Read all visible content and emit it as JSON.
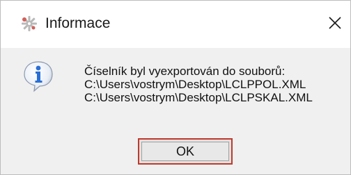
{
  "window": {
    "title": "Informace",
    "title_icon": "gear-cluster-icon",
    "close_glyph": "✕"
  },
  "message": {
    "icon": "information-icon",
    "lines": [
      "Číselník byl vyexportován do souborů:",
      "C:\\Users\\vostrym\\Desktop\\LCLPPOL.XML",
      "C:\\Users\\vostrym\\Desktop\\LCLPSKAL.XML"
    ]
  },
  "buttons": {
    "ok_label": "OK"
  },
  "colors": {
    "title_bg": "#ffffff",
    "body_bg": "#f0f0f0",
    "focus_border": "#c0392b",
    "info_blue": "#2a6fd6"
  }
}
